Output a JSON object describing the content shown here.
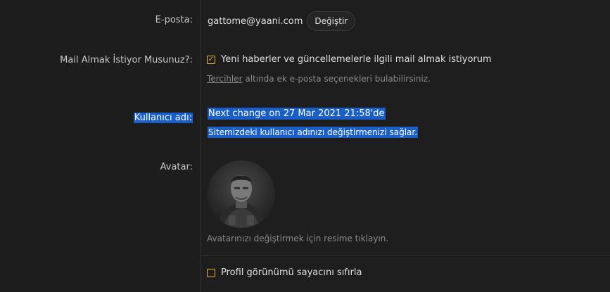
{
  "labels": {
    "email": "E-posta:",
    "mail_opt": "Mail Almak İstiyor Musunuz?:",
    "username": "Kullanıcı adı:",
    "avatar": "Avatar:"
  },
  "email": {
    "value": "gattome@yaani.com",
    "change_label": "Değiştir"
  },
  "mail_opt": {
    "checked": true,
    "text": "Yeni haberler ve güncellemelerle ilgili mail almak istiyorum",
    "hint_link": "Tercihler",
    "hint_rest": " altında ek e-posta seçenekleri bulabilirsiniz."
  },
  "username": {
    "next_change": "Next change on 27 Mar 2021 21:58'de",
    "description": "Sitemizdeki kullanıcı adınızı değiştirmenizi sağlar."
  },
  "avatar": {
    "hint": "Avatarınızı değiştirmek için resime tıklayın."
  },
  "profile_reset": {
    "checked": false,
    "text": "Profil görünümü sayacını sıfırla"
  },
  "colors": {
    "accent": "#e8b53c",
    "selection": "#1a5fc8",
    "background": "#1d1d1d"
  }
}
